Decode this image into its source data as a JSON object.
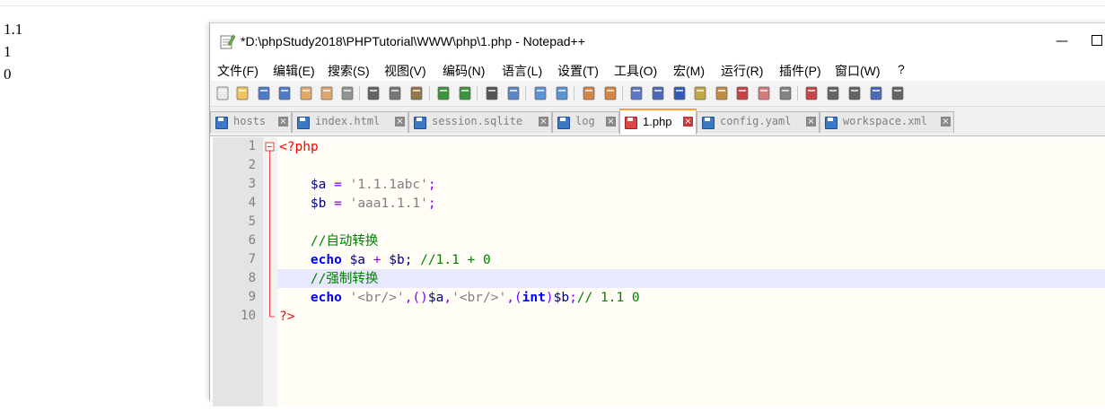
{
  "output_lines": [
    "1.1",
    "1",
    "0"
  ],
  "window": {
    "title": "*D:\\phpStudy2018\\PHPTutorial\\WWW\\php\\1.php - Notepad++",
    "minimize_label": "—"
  },
  "menu": [
    "文件(F)",
    "编辑(E)",
    "搜索(S)",
    "视图(V)",
    "编码(N)",
    "语言(L)",
    "设置(T)",
    "工具(O)",
    "宏(M)",
    "运行(R)",
    "插件(P)",
    "窗口(W)",
    "?"
  ],
  "tabs": [
    {
      "label": "hosts",
      "active": false
    },
    {
      "label": "index.html",
      "active": false
    },
    {
      "label": "session.sqlite",
      "active": false
    },
    {
      "label": "log",
      "active": false
    },
    {
      "label": "1.php",
      "active": true
    },
    {
      "label": "config.yaml",
      "active": false
    },
    {
      "label": "workspace.xml",
      "active": false
    }
  ],
  "tab_close_glyph": "×",
  "line_numbers": [
    "1",
    "2",
    "3",
    "4",
    "5",
    "6",
    "7",
    "8",
    "9",
    "10"
  ],
  "code": {
    "l1": "<?php",
    "l3_var": "$a",
    "l3_op": " = ",
    "l3_str": "'1.1.1abc'",
    "l3_end": ";",
    "l4_var": "$b",
    "l4_op": " = ",
    "l4_str": "'aaa1.1.1'",
    "l4_end": ";",
    "l6_com": "//自动转换",
    "l7_kw": "echo",
    "l7_rest_a": " $a ",
    "l7_plus": "+",
    "l7_rest_b": " $b; ",
    "l7_com": "//1.1 + 0",
    "l8_com": "//强制转换",
    "l9_kw": "echo",
    "l9_s1": " '<br/>'",
    "l9_p1": ",()",
    "l9_v1": "$a",
    "l9_p2": ",",
    "l9_s2": "'<br/>'",
    "l9_p3": ",(",
    "l9_kw2": "int",
    "l9_p4": ")",
    "l9_v2": "$b",
    "l9_p5": ";",
    "l9_com": "// 1.1 0",
    "l10": "?>"
  },
  "toolbar_icons": [
    "new-file-icon",
    "open-file-icon",
    "save-icon",
    "save-all-icon",
    "close-icon",
    "close-all-icon",
    "print-icon",
    "cut-icon",
    "copy-icon",
    "paste-icon",
    "undo-icon",
    "redo-icon",
    "find-icon",
    "replace-icon",
    "zoom-in-icon",
    "zoom-out-icon",
    "sync-v-icon",
    "sync-h-icon",
    "word-wrap-icon",
    "show-all-chars-icon",
    "indent-guide-icon",
    "udl-icon",
    "doc-map-icon",
    "function-list-icon",
    "folder-as-workspace-icon",
    "monitor-icon",
    "record-macro-icon",
    "stop-record-icon",
    "play-macro-icon",
    "run-macro-multiple-icon",
    "save-macro-icon"
  ],
  "colors": {
    "accent_tab": "#f5a336",
    "current_line": "#e8e8ff",
    "php_tag": "#ff0000",
    "keyword": "#0000ff",
    "comment": "#008000",
    "string": "#808080"
  }
}
